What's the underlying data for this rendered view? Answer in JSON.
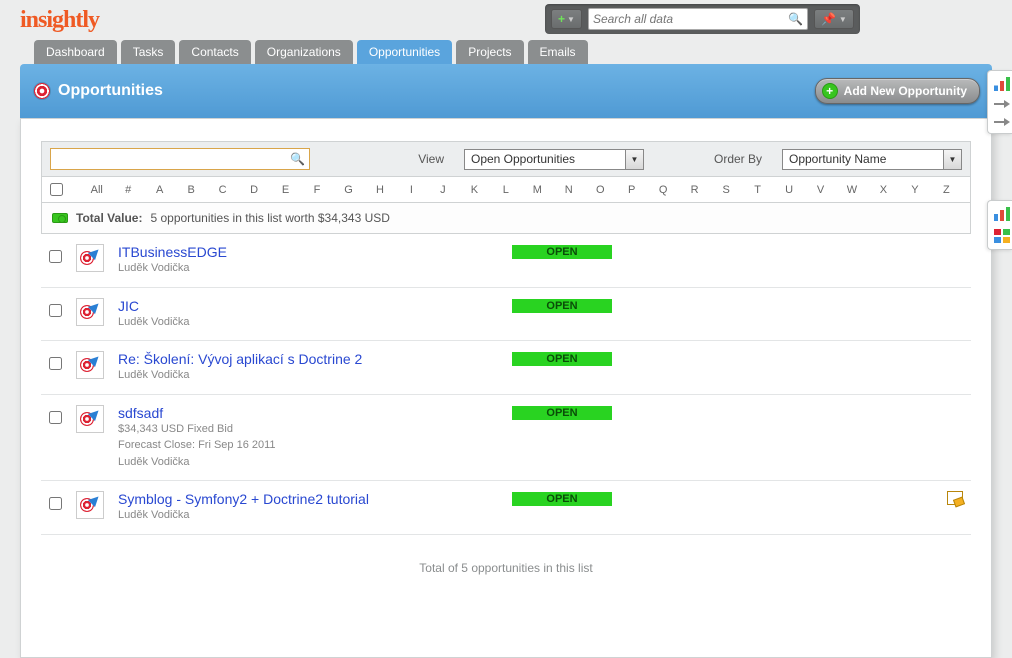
{
  "logo": "insightly",
  "global_search_placeholder": "Search all data",
  "nav": {
    "tabs": [
      {
        "label": "Dashboard",
        "active": false
      },
      {
        "label": "Tasks",
        "active": false
      },
      {
        "label": "Contacts",
        "active": false
      },
      {
        "label": "Organizations",
        "active": false
      },
      {
        "label": "Opportunities",
        "active": true
      },
      {
        "label": "Projects",
        "active": false
      },
      {
        "label": "Emails",
        "active": false
      }
    ]
  },
  "band": {
    "title": "Opportunities",
    "add_label": "Add New Opportunity"
  },
  "filters": {
    "view_label": "View",
    "view_value": "Open Opportunities",
    "orderby_label": "Order By",
    "orderby_value": "Opportunity Name"
  },
  "alpha": [
    "All",
    "#",
    "A",
    "B",
    "C",
    "D",
    "E",
    "F",
    "G",
    "H",
    "I",
    "J",
    "K",
    "L",
    "M",
    "N",
    "O",
    "P",
    "Q",
    "R",
    "S",
    "T",
    "U",
    "V",
    "W",
    "X",
    "Y",
    "Z"
  ],
  "total": {
    "label": "Total Value:",
    "text": "5 opportunities in this list worth $34,343 USD"
  },
  "rows": [
    {
      "title": "ITBusinessEDGE",
      "owner": "Luděk Vodička",
      "status": "OPEN",
      "extra": []
    },
    {
      "title": "JIC",
      "owner": "Luděk Vodička",
      "status": "OPEN",
      "extra": []
    },
    {
      "title": "Re: Školení: Vývoj aplikací s Doctrine 2",
      "owner": "Luděk Vodička",
      "status": "OPEN",
      "extra": []
    },
    {
      "title": "sdfsadf",
      "owner": "Luděk Vodička",
      "status": "OPEN",
      "extra": [
        "$34,343 USD Fixed Bid",
        "Forecast Close: Fri Sep 16 2011"
      ]
    },
    {
      "title": "Symblog - Symfony2 + Doctrine2 tutorial",
      "owner": "Luděk Vodička",
      "status": "OPEN",
      "extra": [],
      "note": true
    }
  ],
  "footer": "Total of 5 opportunities in this list"
}
